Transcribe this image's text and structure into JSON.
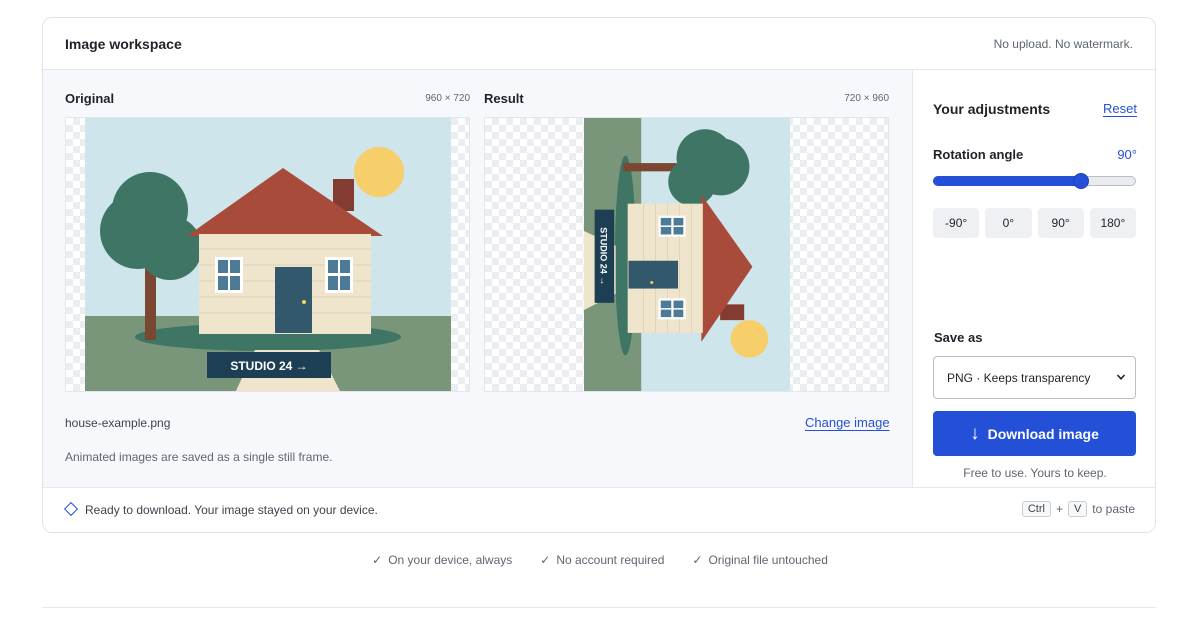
{
  "header": {
    "title": "Image workspace",
    "note": "No upload. No watermark."
  },
  "original": {
    "label": "Original",
    "dimensions": "960 × 720",
    "badge_text": "STUDIO 24 →"
  },
  "result": {
    "label": "Result",
    "dimensions": "720 × 960",
    "badge_text": "STUDIO 24 →"
  },
  "file": {
    "name": "house-example.png",
    "change_label": "Change image"
  },
  "animation_note": "Animated images are saved as a single still frame.",
  "adjustments": {
    "title": "Your adjustments",
    "reset_label": "Reset",
    "rotation_label": "Rotation angle",
    "rotation_value": "90°",
    "slider_fraction": 0.73,
    "presets": [
      "-90°",
      "0°",
      "90°",
      "180°"
    ]
  },
  "save": {
    "label": "Save as",
    "selected_format": "PNG · Keeps transparency",
    "download_label": "Download image",
    "note": "Free to use. Yours to keep."
  },
  "status": {
    "text": "Ready to download. Your image stayed on your device.",
    "key_ctrl": "Ctrl",
    "plus": "+",
    "key_v": "V",
    "paste_suffix": "to paste"
  },
  "trust": [
    "On your device, always",
    "No account required",
    "Original file untouched"
  ],
  "colors": {
    "accent": "#2450d8",
    "sky": "#cfe5ec",
    "grass": "#7a967a",
    "roof": "#a84b3a",
    "tree": "#3e7564",
    "sun": "#f6ce6a",
    "wall": "#efe4cc",
    "door": "#33576b",
    "badge": "#1d3f54"
  }
}
